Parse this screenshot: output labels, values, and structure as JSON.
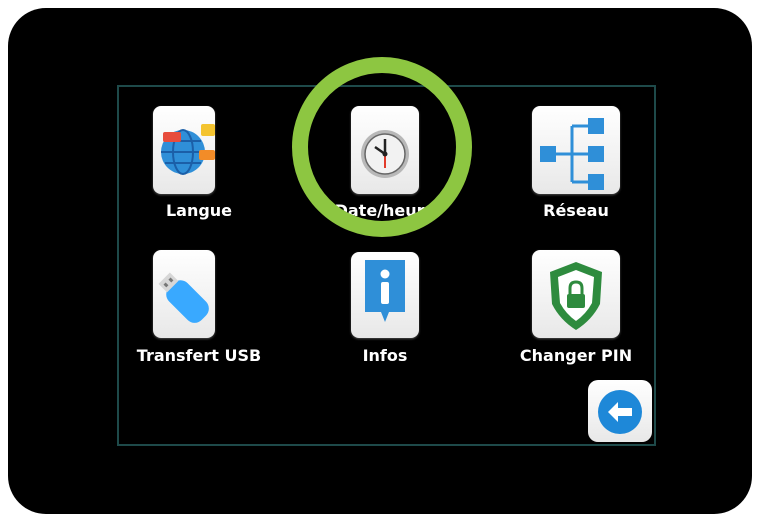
{
  "menu": {
    "items": [
      {
        "label": "Langue",
        "icon": "globe-chat-icon"
      },
      {
        "label": "Date/heure",
        "icon": "clock-icon"
      },
      {
        "label": "Réseau",
        "icon": "network-tree-icon"
      },
      {
        "label": "Transfert USB",
        "icon": "usb-drive-icon"
      },
      {
        "label": "Infos",
        "icon": "info-icon"
      },
      {
        "label": "Changer PIN",
        "icon": "shield-lock-icon"
      }
    ],
    "back": {
      "icon": "back-arrow-icon"
    }
  },
  "colors": {
    "highlight": "#8dc641",
    "screen_border": "#1e4a4a",
    "icon_blue": "#2f8fd8"
  }
}
